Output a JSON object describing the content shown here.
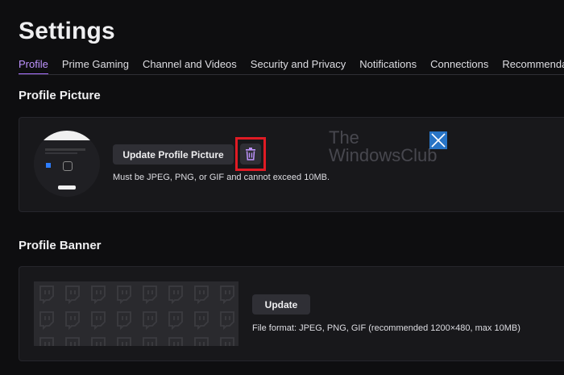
{
  "page": {
    "title": "Settings"
  },
  "tabs": [
    {
      "label": "Profile",
      "active": true
    },
    {
      "label": "Prime Gaming"
    },
    {
      "label": "Channel and Videos"
    },
    {
      "label": "Security and Privacy"
    },
    {
      "label": "Notifications"
    },
    {
      "label": "Connections"
    },
    {
      "label": "Recommendations"
    }
  ],
  "profile_picture": {
    "heading": "Profile Picture",
    "update_label": "Update Profile Picture",
    "hint": "Must be JPEG, PNG, or GIF and cannot exceed 10MB.",
    "delete_icon": "trash-icon"
  },
  "profile_banner": {
    "heading": "Profile Banner",
    "update_label": "Update",
    "hint": "File format: JPEG, PNG, GIF (recommended 1200×480, max 10MB)"
  },
  "watermark": {
    "line1": "The",
    "line2": "WindowsClub"
  },
  "colors": {
    "background": "#0e0e10",
    "card": "#18181b",
    "accent": "#a970ff",
    "button": "#2f2f35",
    "highlight": "#e01b24"
  }
}
